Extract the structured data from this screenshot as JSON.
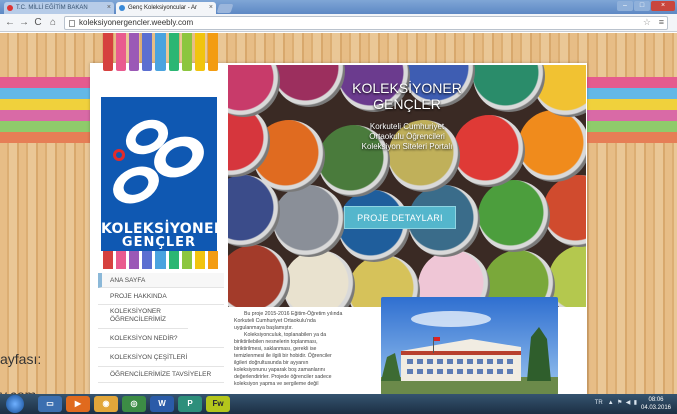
{
  "browser": {
    "tabs": [
      {
        "label": "T.C. MİLLİ EĞİTİM BAKAN",
        "active": false
      },
      {
        "label": "Genç Koleksiyoncular - Ar",
        "active": true
      }
    ],
    "url": "koleksiyonergencler.weebly.com"
  },
  "site": {
    "logo": {
      "line1": "KOLEKSİYONER",
      "line2": "GENÇLER"
    },
    "hero": {
      "title_line1": "KOLEKSİYONER",
      "title_line2": "GENÇLER",
      "subtitle_lines": [
        "Korkuteli Cumhuriyet",
        "Ortaokulu Öğrencileri",
        "Koleksiyon Siteleri Portalı"
      ],
      "cta_label": "PROJE DETAYLARI"
    },
    "menu": [
      {
        "label": "ANA SAYFA",
        "active": true
      },
      {
        "label": "PROJE HAKKINDA",
        "active": false
      },
      {
        "label": "KOLEKSİYONER ÖĞRENCİLERİMİZ",
        "active": false
      },
      {
        "label": "KOLEKSİYON NEDİR?",
        "active": false
      },
      {
        "label": "KOLEKSİYON ÇEŞİTLERİ",
        "active": false
      },
      {
        "label": "ÖĞRENCİLERİMİZE TAVSİYELER",
        "active": false
      }
    ],
    "article_lines": [
      "Bu proje 2015-2016 Eğitim-Öğretim yılında",
      "Korkuteli Cumhuriyet Ortaokulu'nda",
      "uygulanmaya başlamıştır.",
      "Koleksiyonculuk, toplanabilen ya da",
      "biriktirilebilen nesnelerin toplanması,",
      "biriktirilmesi, saklanması, gerekli ise",
      "temizlenmesi ile ilgili bir hobidir. Öğrenciler",
      "ilgileri doğrultusunda bir ayyanın",
      "koleksiyonunu yaparak boş zamanlarını",
      "değerlendirirler. Projede öğrenciler sadece",
      "koleksiyon yapma ve sergileme değil"
    ]
  },
  "background_overlay": {
    "line1": "ayfası:",
    "line2": "y.com"
  },
  "taskbar": {
    "apps": [
      "W",
      "P",
      "Fw"
    ],
    "tray_lang": "TR",
    "clock_time": "08:06",
    "clock_date": "04.03.2016"
  },
  "colors": {
    "pencil_top": [
      "#d6413f",
      "#e95b8f",
      "#9b59b6",
      "#5b6fd1",
      "#4aa3df",
      "#2bb673",
      "#8cc63f",
      "#f1c40f",
      "#f39c12"
    ],
    "stripe_bands": [
      "#e55b8e",
      "#63b8e6",
      "#f0d13c",
      "#d96aa6",
      "#8fcb6b",
      "#e67e56"
    ],
    "logo_bg": "#0f58b2",
    "cta_bg": "#54b6cc"
  }
}
